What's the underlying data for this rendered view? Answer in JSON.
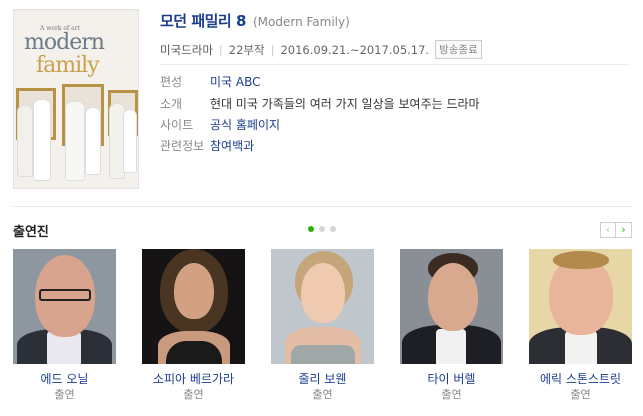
{
  "poster": {
    "small_text": "A work of art",
    "logo_line1": "modern",
    "logo_line2": "family"
  },
  "title": {
    "main": "모던 패밀리 8",
    "original": "(Modern Family)"
  },
  "meta": {
    "genre": "미국드라마",
    "episodes": "22부작",
    "period": "2016.09.21.~2017.05.17.",
    "status_badge": "방송종료"
  },
  "info": [
    {
      "key": "편성",
      "value": "미국 ABC"
    },
    {
      "key": "소개",
      "value": "현대 미국 가족들의 여러 가지 일상을 보여주는 드라마"
    },
    {
      "key": "사이트",
      "value": "공식 홈페이지"
    },
    {
      "key": "관련정보",
      "value": "참여백과"
    }
  ],
  "cast_section": {
    "title": "출연진",
    "pager": {
      "pages": 3,
      "active": 1
    },
    "prev_icon": "chevron-left-icon",
    "next_icon": "chevron-right-icon",
    "members": [
      {
        "name": "에드 오닐",
        "role": "출연"
      },
      {
        "name": "소피아 베르가라",
        "role": "출연"
      },
      {
        "name": "줄리 보웬",
        "role": "출연"
      },
      {
        "name": "타이 버렐",
        "role": "출연"
      },
      {
        "name": "에릭 스톤스트릿",
        "role": "출연"
      }
    ]
  },
  "colors": {
    "link_blue": "#1a3d8f",
    "accent_green": "#2cb400"
  }
}
